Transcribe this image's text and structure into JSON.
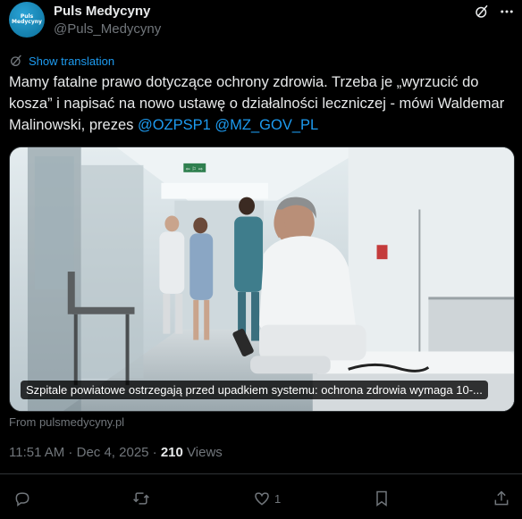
{
  "author": {
    "avatar_text_line1": "Puls",
    "avatar_text_line2": "Medycyny",
    "name": "Puls Medycyny",
    "handle": "@Puls_Medycyny"
  },
  "translate": {
    "label": "Show translation"
  },
  "tweet": {
    "text_before": "Mamy fatalne prawo dotyczące ochrony zdrowia. Trzeba je „wyrzucić do kosza” i napisać na nowo ustawę o działalności leczniczej - mówi Waldemar Malinowski, prezes ",
    "mention1": "@OZPSP1",
    "mention2": "@MZ_GOV_PL"
  },
  "card": {
    "title": "Szpitale powiatowe ostrzegają przed upadkiem systemu: ochrona zdrowia wymaga 10-...",
    "exit_sign": "⇦ ⚐ ⇨"
  },
  "source": "From pulsmedycyny.pl",
  "meta": {
    "time": "11:51 AM",
    "separator1": " · ",
    "date": "Dec 4, 2025",
    "separator2": " · ",
    "views_count": "210",
    "views_label": " Views"
  },
  "actions": {
    "reply_count": "",
    "repost_count": "",
    "like_count": "1"
  },
  "colors": {
    "background": "#000000",
    "text": "#e7e9ea",
    "secondary": "#71767b",
    "link": "#1d9bf0"
  }
}
